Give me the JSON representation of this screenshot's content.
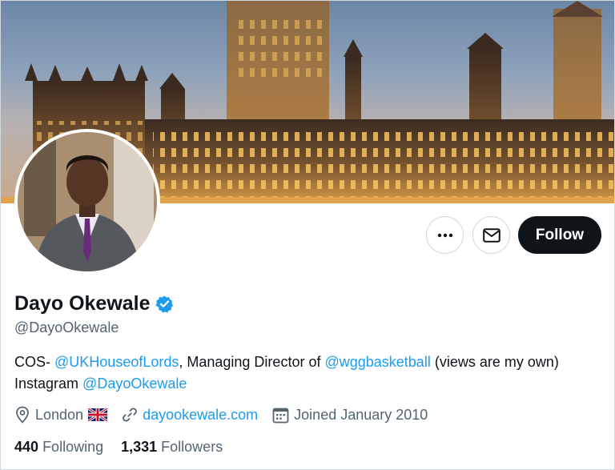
{
  "profile": {
    "name": "Dayo Okewale",
    "handle": "@DayoOkewale",
    "verified_color": "#1d9bf0",
    "bio": {
      "t1": "COS- ",
      "mention1": "@UKHouseofLords",
      "t2": ", Managing Director of ",
      "mention2": "@wggbasketball",
      "t3": " (views are my own)",
      "t4": "Instagram ",
      "mention3": "@DayoOkewale"
    },
    "location": "London",
    "location_flag": "🇬🇧",
    "website": "dayookewale.com",
    "joined": "Joined January 2010",
    "following_count": "440",
    "following_label": "Following",
    "followers_count": "1,331",
    "followers_label": "Followers"
  },
  "actions": {
    "more_icon": "more-icon",
    "mail_icon": "envelope-icon",
    "follow_label": "Follow"
  },
  "colors": {
    "accent": "#1d9bf0",
    "text_primary": "#0f1419",
    "text_secondary": "#536471",
    "follow_bg": "#0f1419"
  }
}
